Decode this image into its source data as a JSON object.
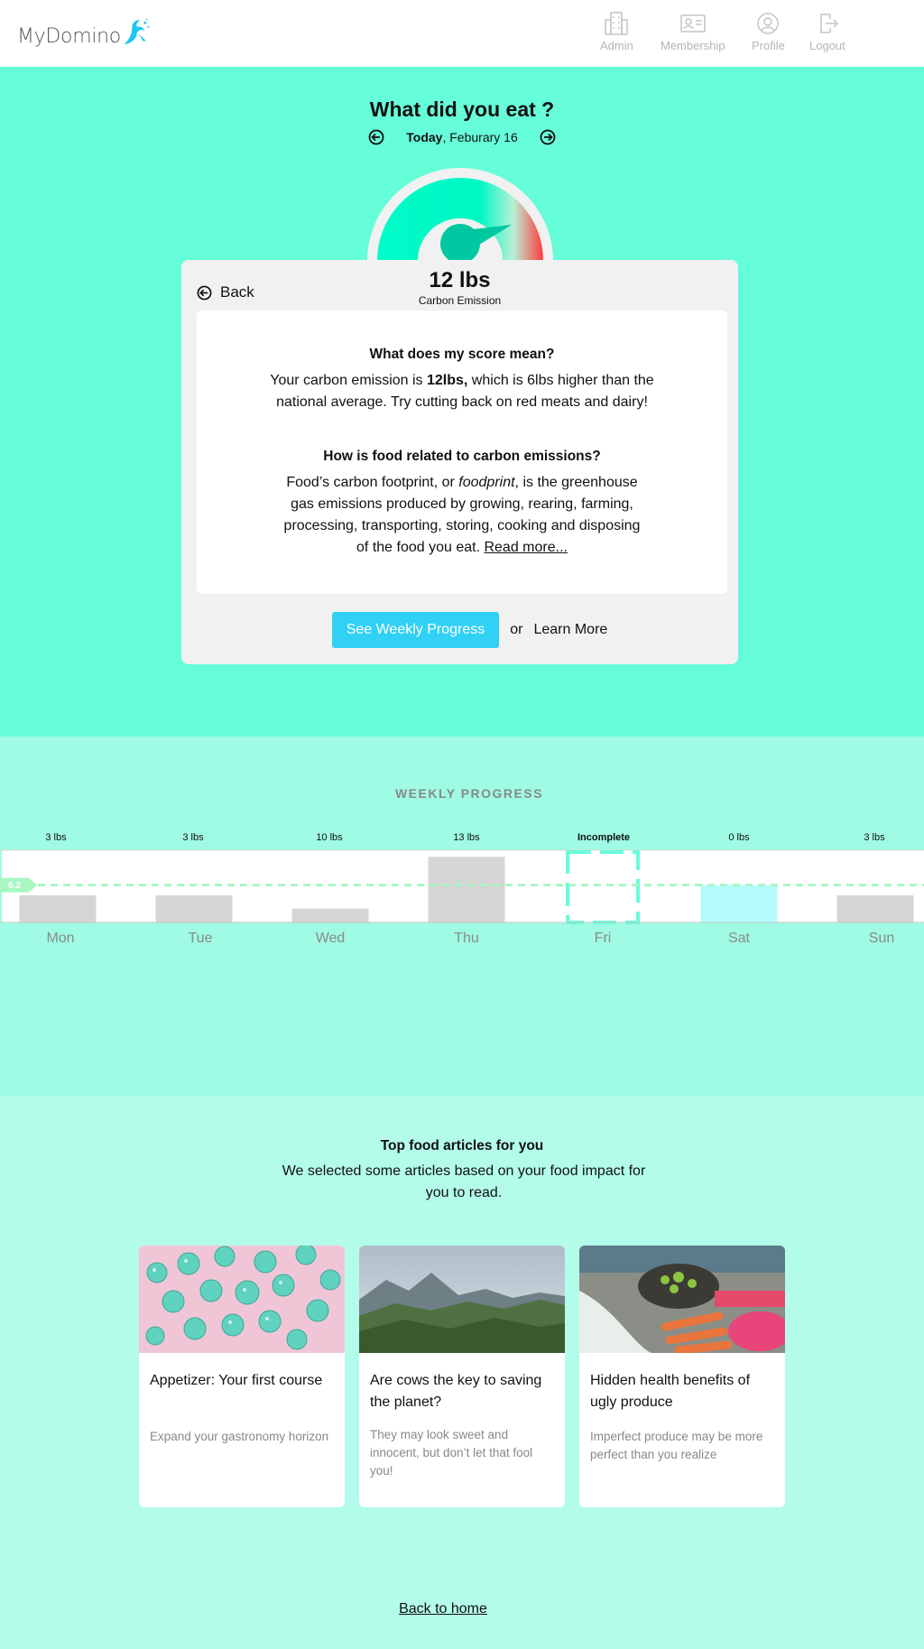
{
  "header": {
    "logo_text": "MyDomino",
    "nav": [
      {
        "label": "Admin",
        "icon": "building-icon"
      },
      {
        "label": "Membership",
        "icon": "id-card-icon"
      },
      {
        "label": "Profile",
        "icon": "user-circle-icon"
      },
      {
        "label": "Logout",
        "icon": "logout-icon"
      }
    ]
  },
  "hero": {
    "title": "What did you eat ?",
    "date_bold": "Today",
    "date_rest": ", Feburary 16",
    "gauge_level": 0.9
  },
  "score_card": {
    "back_label": "Back",
    "score": "12 lbs",
    "score_label": "Carbon Emission",
    "q1": "What does my score mean?",
    "a1_pre": "Your carbon emission is ",
    "a1_bold": "12lbs,",
    "a1_post": " which is 6lbs higher than the national average. Try cutting back on red meats and dairy!",
    "q2": "How is food related to carbon emissions?",
    "a2_pre": "Food’s carbon footprint, or ",
    "a2_italic": "foodprint",
    "a2_post": ", is the greenhouse gas emissions produced by growing, rearing, farming, processing, transporting, storing, cooking and disposing of the food you eat. ",
    "read_more": "Read more...",
    "primary_button": "See Weekly Progress",
    "or_text": "or",
    "learn_more": "Learn More"
  },
  "weekly": {
    "title": "WEEKLY PROGRESS"
  },
  "chart_data": {
    "type": "bar",
    "categories": [
      "Mon",
      "Tue",
      "Wed",
      "Thu",
      "Fri",
      "Sat",
      "Sun"
    ],
    "value_labels": [
      "3 lbs",
      "3 lbs",
      "10 lbs",
      "13 lbs",
      "Incomplete",
      "0 lbs",
      "3 lbs"
    ],
    "bar_heights": [
      4.5,
      4.5,
      2.3,
      10.9,
      null,
      6.2,
      4.5
    ],
    "average": 6.2,
    "average_label": "6.2",
    "ylim": [
      0,
      12
    ],
    "colors": {
      "default": "#d5d5d5",
      "highlight": "#b4fbfd",
      "average": "#a8f7c3",
      "incomplete": "#66fdd9"
    }
  },
  "articles": {
    "title": "Top food articles for you",
    "subtitle": "We selected some articles based on your food impact for you to read.",
    "items": [
      {
        "title": "Appetizer: Your first course",
        "desc": "Expand your gastronomy horizon"
      },
      {
        "title": "Are cows the key to saving the planet?",
        "desc": "They may look sweet and innocent, but don’t let that fool you!"
      },
      {
        "title": "Hidden health benefits of ugly produce",
        "desc": "Imperfect produce may be more perfect than you realize"
      }
    ],
    "back_home": "Back to home"
  }
}
